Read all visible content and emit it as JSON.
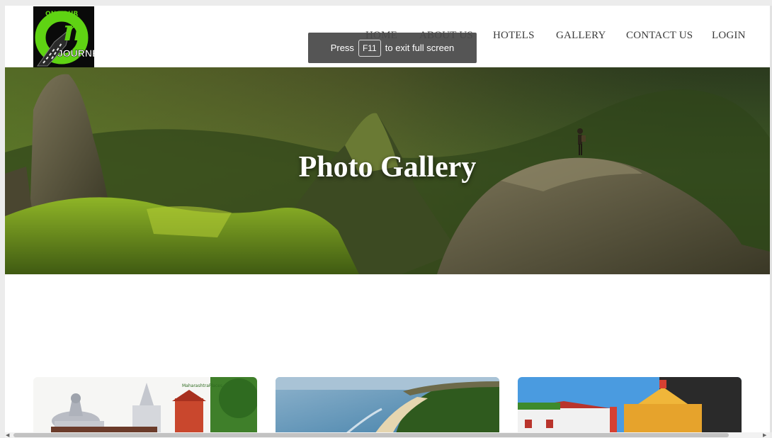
{
  "logo": {
    "text_top": "ON YOUR",
    "text_letter": "n",
    "text_bottom": "JOURNEY"
  },
  "nav": {
    "items": [
      {
        "label": "HOME"
      },
      {
        "label": "ABOUT US"
      },
      {
        "label": "HOTELS"
      },
      {
        "label": "GALLERY"
      },
      {
        "label": "CONTACT US"
      },
      {
        "label": "LOGIN"
      }
    ]
  },
  "fullscreen_toast": {
    "prefix": "Press",
    "key": "F11",
    "suffix": "to exit full screen"
  },
  "hero": {
    "title": "Photo Gallery"
  },
  "gallery": {
    "cards": [
      {
        "caption_mark": "MaharashtraPlaces"
      },
      {
        "caption_mark": ""
      },
      {
        "caption_mark": ""
      }
    ]
  },
  "colors": {
    "logo_green": "#5fd313",
    "nav_text": "#3b3b3b",
    "hero_title": "#ffffff"
  }
}
